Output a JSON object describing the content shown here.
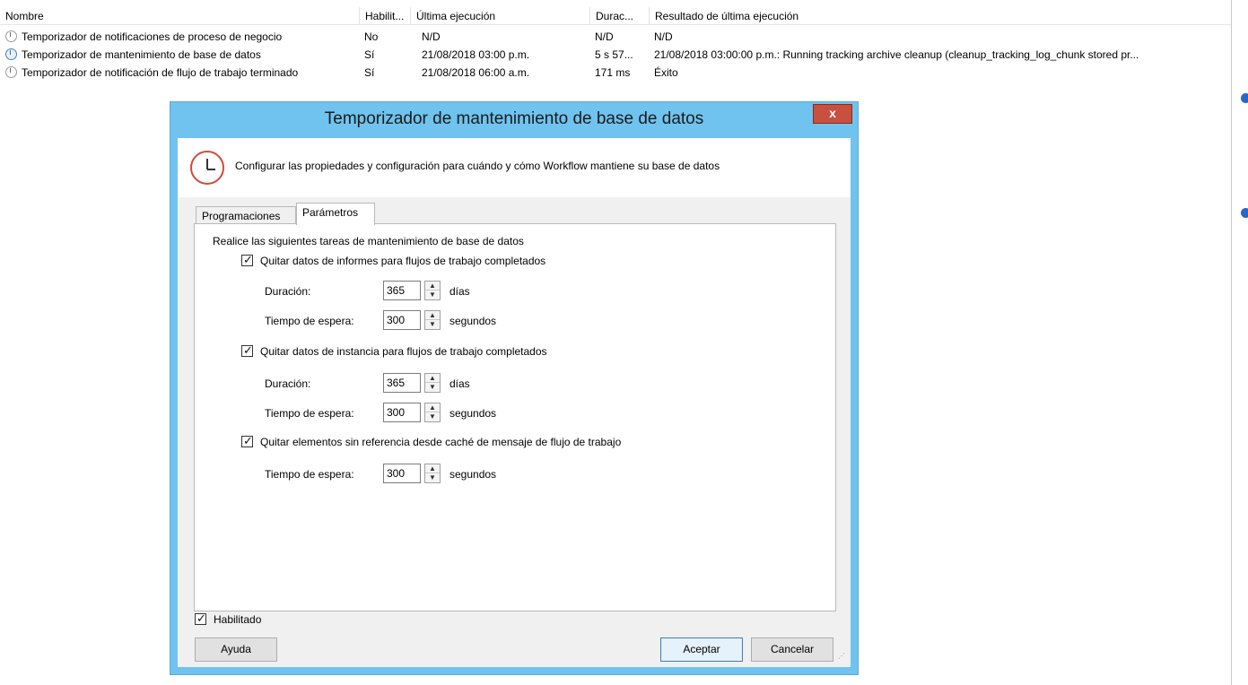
{
  "list": {
    "columns": [
      "Nombre",
      "Habilit...",
      "Última ejecución",
      "Durac...",
      "Resultado de última ejecución"
    ],
    "rows": [
      {
        "name": "Temporizador de notificaciones de proceso de negocio",
        "enabled": "No",
        "last_run": "N/D",
        "duration": "N/D",
        "result": "N/D"
      },
      {
        "name": "Temporizador de mantenimiento de base de datos",
        "enabled": "Sí",
        "last_run": "21/08/2018 03:00 p.m.",
        "duration": "5 s 57...",
        "result": "21/08/2018 03:00:00 p.m.: Running tracking archive cleanup (cleanup_tracking_log_chunk stored pr..."
      },
      {
        "name": "Temporizador de notificación de flujo de trabajo terminado",
        "enabled": "Sí",
        "last_run": "21/08/2018 06:00 a.m.",
        "duration": "171 ms",
        "result": "Éxito"
      }
    ]
  },
  "dialog": {
    "title": "Temporizador de mantenimiento de base de datos",
    "close_label": "x",
    "description": "Configurar las propiedades y configuración para cuándo y cómo Workflow mantiene su base de datos",
    "tabs": [
      "Programaciones",
      "Parámetros"
    ],
    "selected_tab": "Parámetros",
    "intro": "Realice las siguientes tareas de mantenimiento de base de datos",
    "sections": [
      {
        "label": "Quitar datos de informes para flujos de trabajo completados",
        "checked": true,
        "fields": [
          {
            "label": "Duración:",
            "value": "365",
            "unit": "días"
          },
          {
            "label": "Tiempo de espera:",
            "value": "300",
            "unit": "segundos"
          }
        ]
      },
      {
        "label": "Quitar datos de instancia para flujos de trabajo completados",
        "checked": true,
        "fields": [
          {
            "label": "Duración:",
            "value": "365",
            "unit": "días"
          },
          {
            "label": "Tiempo de espera:",
            "value": "300",
            "unit": "segundos"
          }
        ]
      },
      {
        "label": "Quitar elementos sin referencia desde caché de mensaje de flujo de trabajo",
        "checked": true,
        "fields": [
          {
            "label": "Tiempo de espera:",
            "value": "300",
            "unit": "segundos"
          }
        ]
      }
    ],
    "enabled_label": "Habilitado",
    "enabled_checked": true,
    "help_button": "Ayuda",
    "ok_button": "Aceptar",
    "cancel_button": "Cancelar"
  },
  "colors": {
    "dialog_frame": "#6fc3ee",
    "close_button": "#c7503e",
    "clock_accent": "#d24a3a"
  }
}
